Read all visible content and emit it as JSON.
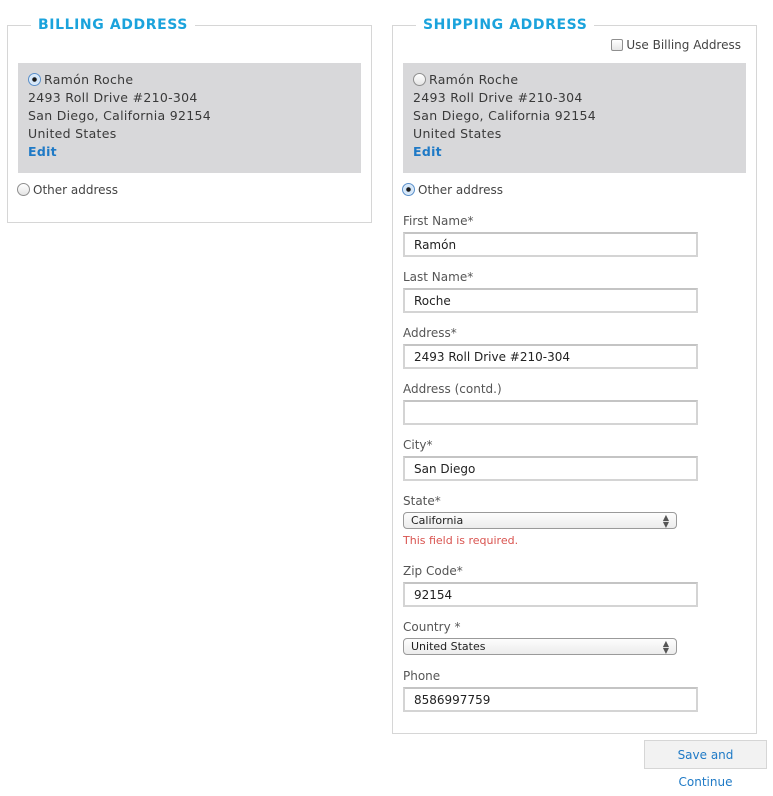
{
  "billing": {
    "title": "BILLING ADDRESS",
    "saved_address": {
      "selected": true,
      "name": "Ramón Roche",
      "line1": "2493 Roll Drive #210-304",
      "line2": "San Diego, California 92154",
      "country": "United States",
      "edit_label": "Edit"
    },
    "other_address": {
      "label": "Other address",
      "selected": false
    }
  },
  "shipping": {
    "title": "SHIPPING ADDRESS",
    "use_billing": {
      "label": "Use Billing Address",
      "checked": false
    },
    "saved_address": {
      "selected": false,
      "name": "Ramón Roche",
      "line1": "2493 Roll Drive #210-304",
      "line2": "San Diego, California 92154",
      "country": "United States",
      "edit_label": "Edit"
    },
    "other_address": {
      "label": "Other address",
      "selected": true
    },
    "form": {
      "first_name": {
        "label": "First Name*",
        "value": "Ramón"
      },
      "last_name": {
        "label": "Last Name*",
        "value": "Roche"
      },
      "address": {
        "label": "Address*",
        "value": "2493 Roll Drive #210-304"
      },
      "address2": {
        "label": "Address (contd.)",
        "value": ""
      },
      "city": {
        "label": "City*",
        "value": "San Diego"
      },
      "state": {
        "label": "State*",
        "value": "California",
        "error": "This field is required."
      },
      "zip": {
        "label": "Zip Code*",
        "value": "92154"
      },
      "country": {
        "label": "Country *",
        "value": "United States"
      },
      "phone": {
        "label": "Phone",
        "value": "8586997759"
      }
    }
  },
  "actions": {
    "save_label": "Save and Continue"
  },
  "colors": {
    "accent": "#1ba3dc",
    "link": "#1f7ac6",
    "error": "#d9534f",
    "address_box_bg": "#d8d8da"
  }
}
